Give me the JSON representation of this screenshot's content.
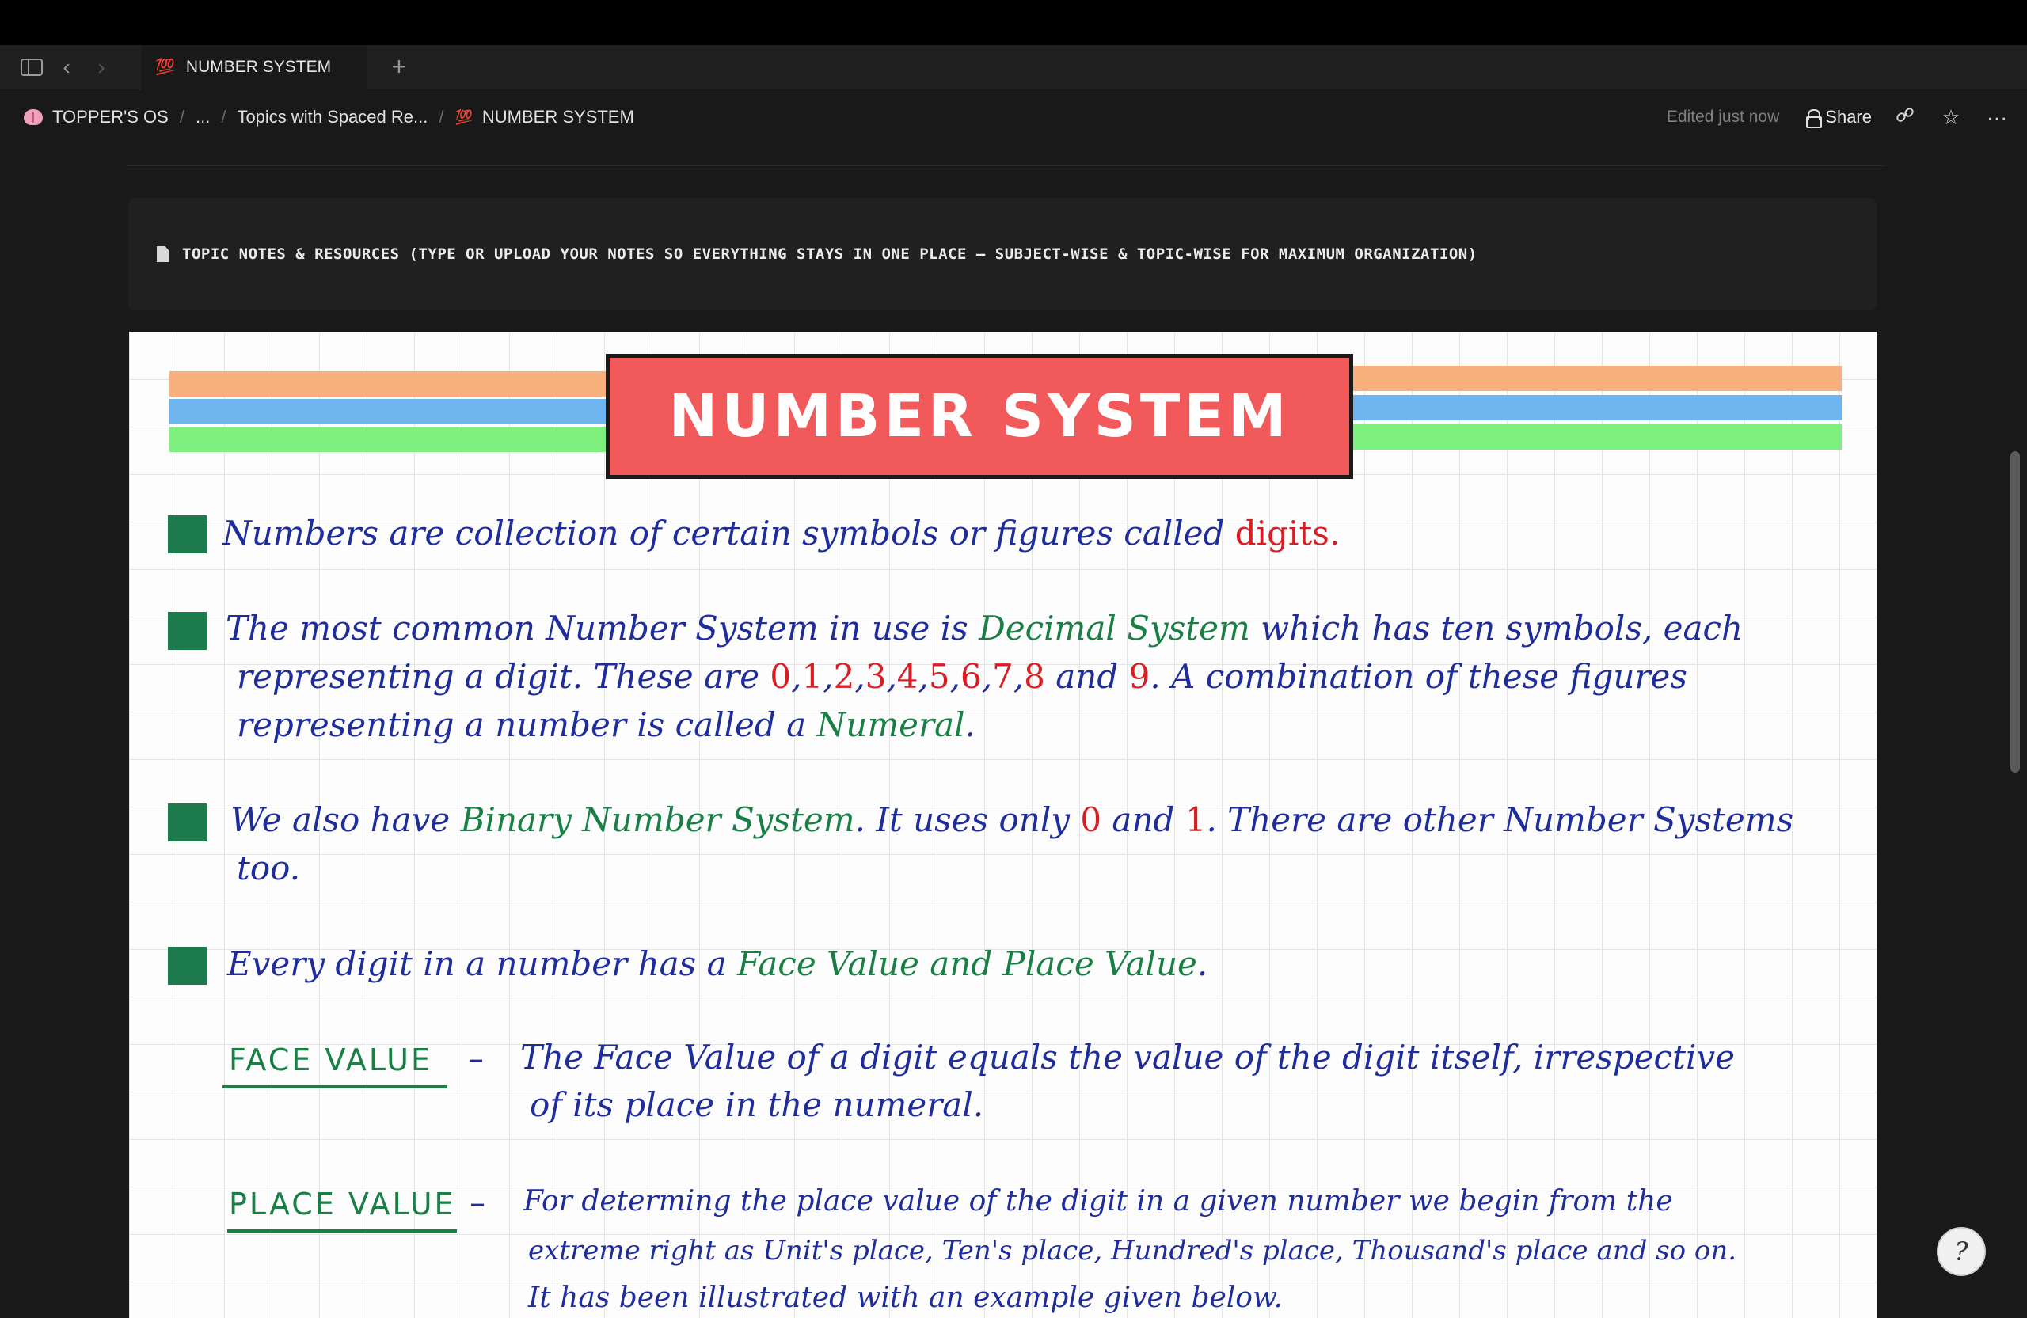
{
  "tabs": [
    {
      "label": "NUMBER SYSTEM",
      "icon": "hundred-icon"
    }
  ],
  "breadcrumb": {
    "items": [
      "TOPPER'S OS",
      "...",
      "Topics with Spaced Re...",
      "NUMBER SYSTEM"
    ],
    "separator": "/"
  },
  "header": {
    "edited": "Edited just now",
    "share_label": "Share"
  },
  "callout": {
    "text": "TOPIC NOTES & RESOURCES (TYPE OR UPLOAD YOUR NOTES SO EVERYTHING STAYS IN ONE PLACE – SUBJECT-WISE & TOPIC-WISE FOR MAXIMUM ORGANIZATION)"
  },
  "note": {
    "title": "NUMBER SYSTEM",
    "p1": {
      "a": "Numbers are collection of certain symbols or figures called ",
      "digits": "digits",
      "end": "."
    },
    "p2": {
      "l1a": "The most common Number System in use is ",
      "l1g": "Decimal System",
      "l1b": " which has ten symbols, each",
      "l2a": "representing a digit. These are ",
      "d0": "0",
      "d1": "1",
      "d2": "2",
      "d3": "3",
      "d4": "4",
      "d5": "5",
      "d6": "6",
      "d7": "7",
      "d8": "8",
      "d9": "9",
      "comma": ",",
      "and": " and ",
      "l2b": ". A combination of these figures",
      "l3a": "representing a number is called a ",
      "l3g": "Numeral",
      "l3b": "."
    },
    "p3": {
      "l1a": "We also have ",
      "l1g": "Binary Number System",
      "l1b": ". It uses only ",
      "zero": "0",
      "and": " and ",
      "one": "1",
      "l1c": ". There are other Number Systems",
      "l2": "too."
    },
    "p4": {
      "a": "Every digit in a number has a ",
      "g": "Face Value and Place Value",
      "b": "."
    },
    "face": {
      "label": "FACE VALUE",
      "dash": "–",
      "l1": "The Face Value of a digit equals the value of the digit itself, irrespective",
      "l2": "of its place in the numeral."
    },
    "place": {
      "label": "PLACE VALUE",
      "dash": "–",
      "l1": "For determing the place value of the digit in a given number we begin from the",
      "l2": "extreme right as Unit's place, Ten's place, Hundred's place, Thousand's place and so on.",
      "l3": "It has been illustrated with an example given below."
    }
  },
  "colors": {
    "stripe_orange": "#f8b07c",
    "stripe_blue": "#6fb6f0",
    "stripe_green": "#7ef07e",
    "title_red": "#f2595a",
    "bullet_green": "#1c7a4c",
    "ink_blue": "#1f2d9c",
    "ink_green": "#1a7f45",
    "ink_red": "#d81e22"
  }
}
